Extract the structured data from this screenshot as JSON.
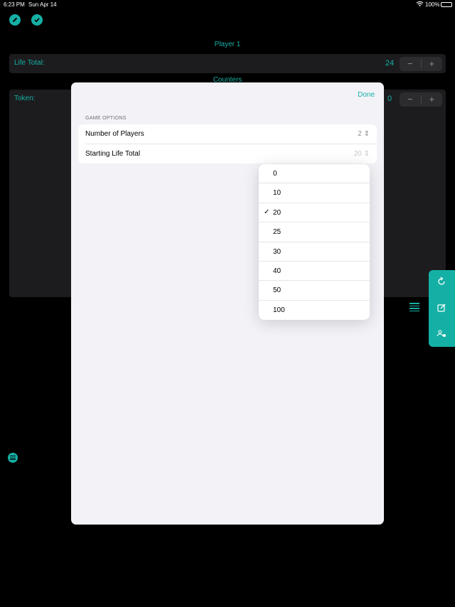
{
  "status": {
    "time": "6:23 PM",
    "date": "Sun Apr 14",
    "battery": "100%"
  },
  "top_buttons": [
    {
      "name": "edit-pencil-button",
      "icon": "pencil-icon"
    },
    {
      "name": "confirm-button",
      "icon": "checkmark-icon"
    }
  ],
  "background": {
    "player_title": "Player 1",
    "life_label": "Life Total:",
    "life_value": "24",
    "counters_title": "Counters",
    "token_label": "Token:",
    "token_value": "0",
    "minus": "−",
    "plus": "+"
  },
  "side_panel": {
    "icons": [
      "reset-icon",
      "edit-note-icon",
      "players-settings-icon"
    ]
  },
  "sheet": {
    "done_label": "Done",
    "section_title": "GAME OPTIONS",
    "rows": [
      {
        "label": "Number of Players",
        "value": "2"
      },
      {
        "label": "Starting Life Total",
        "value": "20"
      }
    ]
  },
  "dropdown": {
    "options": [
      "0",
      "10",
      "20",
      "25",
      "30",
      "40",
      "50",
      "100"
    ],
    "selected": "20",
    "check_mark": "✓"
  },
  "colors": {
    "accent": "#15b0a5",
    "sheet_bg": "#f2f2f7"
  }
}
